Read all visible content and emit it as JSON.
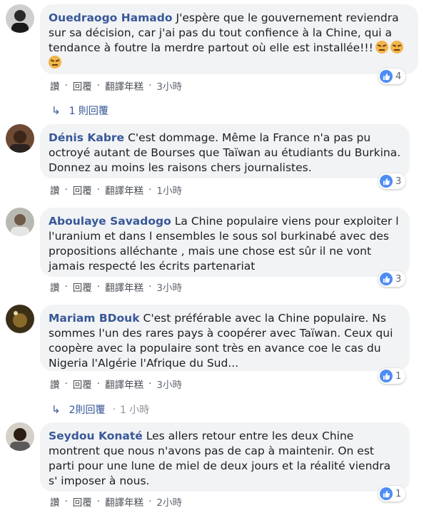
{
  "colors": {
    "name": "#385898",
    "bubble": "#f2f3f5",
    "like": "#4e8cf5"
  },
  "comments": [
    {
      "author": "Ouedraogo Hamado",
      "text": "J'espère que le gouvernement reviendra sur sa décision, car j'ai pas du tout confience à la Chine, qui a tendance à foutre la merdre partout où elle est installée!!!",
      "emoji_count": 3,
      "likes": "4",
      "actions": {
        "like": "讚",
        "reply": "回覆",
        "translate": "翻譯年糕",
        "time": "3小時"
      },
      "replies": {
        "label": "1 則回覆"
      }
    },
    {
      "author": "Dénis Kabre",
      "text": "C'est dommage. Même la France n'a pas pu octroyé autant de Bourses que Taïwan au étudiants du Burkina. Donnez au moins les raisons chers journalistes.",
      "likes": "3",
      "actions": {
        "like": "讚",
        "reply": "回覆",
        "translate": "翻譯年糕",
        "time": "1小時"
      }
    },
    {
      "author": "Aboulaye Savadogo",
      "text": "La Chine populaire viens pour exploiter l l'uranium et dans l ensembles le sous sol burkinabé avec des propositions alléchante , mais une chose est sûr il ne vont jamais respecté les écrits partenariat",
      "likes": "3",
      "actions": {
        "like": "讚",
        "reply": "回覆",
        "translate": "翻譯年糕",
        "time": "3小時"
      }
    },
    {
      "author": "Mariam BDouk",
      "text": "C'est préférable avec la Chine populaire. Ns sommes l'un des rares pays à coopérer avec Taïwan. Ceux qui coopère avec la populaire sont très en avance coe le cas du Nigeria l'Algérie l'Afrique du Sud...",
      "likes": "1",
      "actions": {
        "like": "讚",
        "reply": "回覆",
        "translate": "翻譯年糕",
        "time": "3小時"
      },
      "replies": {
        "label": "2則回覆",
        "time": "1 小時"
      }
    },
    {
      "author": "Seydou Konaté",
      "text": "Les allers retour entre les deux Chine montrent que nous n'avons pas de cap à maintenir. On est parti pour une lune de miel de deux jours et la réalité viendra s' imposer à nous.",
      "likes": "1",
      "actions": {
        "like": "讚",
        "reply": "回覆",
        "translate": "翻譯年糕",
        "time": "2小時"
      }
    }
  ]
}
